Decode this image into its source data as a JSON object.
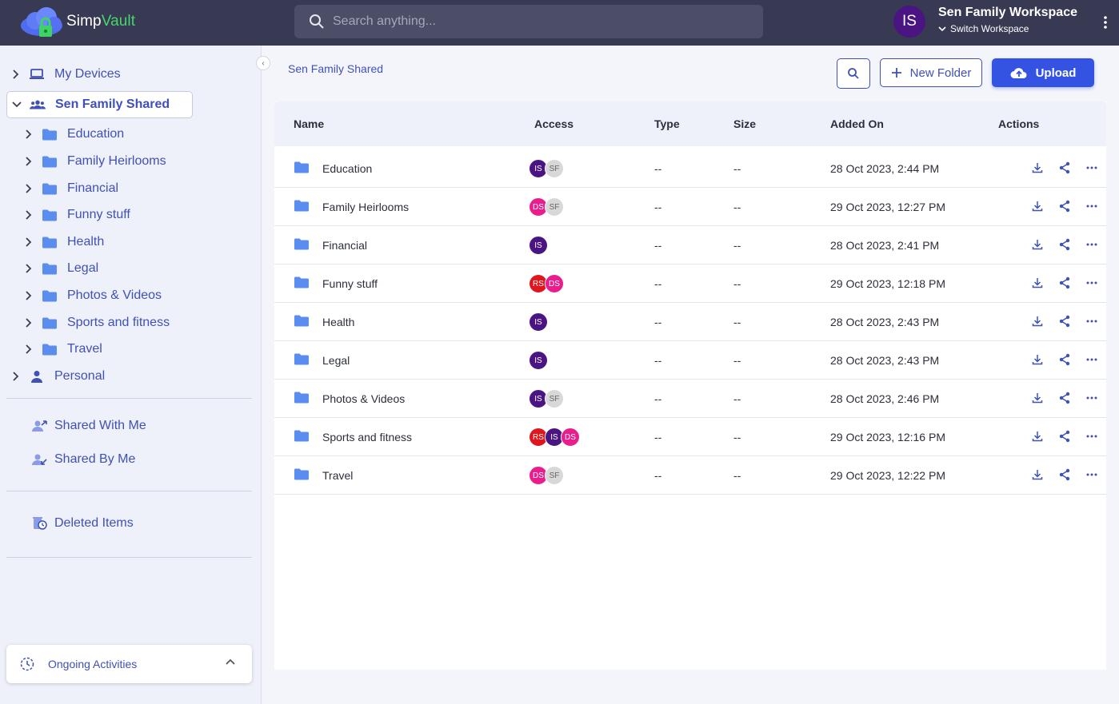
{
  "app": {
    "name_part1": "Simp",
    "name_part2": "Vault"
  },
  "search": {
    "placeholder": "Search anything..."
  },
  "workspace": {
    "avatar_initials": "IS",
    "name": "Sen Family Workspace",
    "switch_label": "Switch Workspace"
  },
  "sidebar": {
    "my_devices": "My Devices",
    "shared_root": "Sen Family Shared",
    "folders": [
      "Education",
      "Family Heirlooms",
      "Financial",
      "Funny stuff",
      "Health",
      "Legal",
      "Photos & Videos",
      "Sports and fitness",
      "Travel"
    ],
    "personal": "Personal",
    "shared_with_me": "Shared With Me",
    "shared_by_me": "Shared By Me",
    "deleted_items": "Deleted Items",
    "ongoing_activities": "Ongoing Activities"
  },
  "breadcrumb": "Sen Family Shared",
  "toolbar": {
    "new_folder": "New Folder",
    "upload": "Upload"
  },
  "table": {
    "headers": {
      "name": "Name",
      "access": "Access",
      "type": "Type",
      "size": "Size",
      "added_on": "Added On",
      "actions": "Actions"
    },
    "rows": [
      {
        "name": "Education",
        "access": [
          {
            "initials": "IS",
            "color": "#4b1483"
          },
          {
            "initials": "SF",
            "color": "#d8d8d8"
          }
        ],
        "type": "--",
        "size": "--",
        "added_on": "28 Oct 2023, 2:44 PM"
      },
      {
        "name": "Family Heirlooms",
        "access": [
          {
            "initials": "DS",
            "color": "#e91e8c"
          },
          {
            "initials": "SF",
            "color": "#d8d8d8"
          }
        ],
        "type": "--",
        "size": "--",
        "added_on": "29 Oct 2023, 12:27 PM"
      },
      {
        "name": "Financial",
        "access": [
          {
            "initials": "IS",
            "color": "#4b1483"
          }
        ],
        "type": "--",
        "size": "--",
        "added_on": "28 Oct 2023, 2:41 PM"
      },
      {
        "name": "Funny stuff",
        "access": [
          {
            "initials": "RS",
            "color": "#e0161e"
          },
          {
            "initials": "DS",
            "color": "#e91e8c"
          }
        ],
        "type": "--",
        "size": "--",
        "added_on": "29 Oct 2023, 12:18 PM"
      },
      {
        "name": "Health",
        "access": [
          {
            "initials": "IS",
            "color": "#4b1483"
          }
        ],
        "type": "--",
        "size": "--",
        "added_on": "28 Oct 2023, 2:43 PM"
      },
      {
        "name": "Legal",
        "access": [
          {
            "initials": "IS",
            "color": "#4b1483"
          }
        ],
        "type": "--",
        "size": "--",
        "added_on": "28 Oct 2023, 2:43 PM"
      },
      {
        "name": "Photos & Videos",
        "access": [
          {
            "initials": "IS",
            "color": "#4b1483"
          },
          {
            "initials": "SF",
            "color": "#d8d8d8"
          }
        ],
        "type": "--",
        "size": "--",
        "added_on": "28 Oct 2023, 2:46 PM"
      },
      {
        "name": "Sports and fitness",
        "access": [
          {
            "initials": "RS",
            "color": "#e0161e"
          },
          {
            "initials": "IS",
            "color": "#4b1483"
          },
          {
            "initials": "DS",
            "color": "#e91e8c"
          }
        ],
        "type": "--",
        "size": "--",
        "added_on": "29 Oct 2023, 12:16 PM"
      },
      {
        "name": "Travel",
        "access": [
          {
            "initials": "DS",
            "color": "#e91e8c"
          },
          {
            "initials": "SF",
            "color": "#d8d8d8"
          }
        ],
        "type": "--",
        "size": "--",
        "added_on": "29 Oct 2023, 12:22 PM"
      }
    ]
  },
  "colors": {
    "topbar": "#373a52",
    "accent": "#3f51b5",
    "primary_button": "#3453e3",
    "folder": "#5b8def",
    "brand_green": "#45d66e"
  }
}
